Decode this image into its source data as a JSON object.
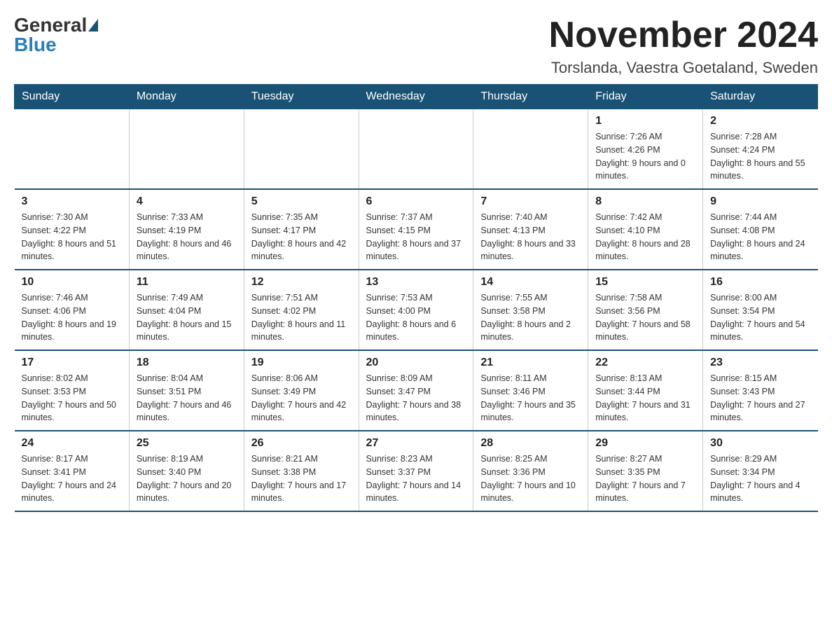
{
  "header": {
    "logo_general": "General",
    "logo_blue": "Blue",
    "month_title": "November 2024",
    "location": "Torslanda, Vaestra Goetaland, Sweden"
  },
  "weekdays": [
    "Sunday",
    "Monday",
    "Tuesday",
    "Wednesday",
    "Thursday",
    "Friday",
    "Saturday"
  ],
  "weeks": [
    [
      {
        "day": "",
        "info": ""
      },
      {
        "day": "",
        "info": ""
      },
      {
        "day": "",
        "info": ""
      },
      {
        "day": "",
        "info": ""
      },
      {
        "day": "",
        "info": ""
      },
      {
        "day": "1",
        "info": "Sunrise: 7:26 AM\nSunset: 4:26 PM\nDaylight: 9 hours and 0 minutes."
      },
      {
        "day": "2",
        "info": "Sunrise: 7:28 AM\nSunset: 4:24 PM\nDaylight: 8 hours and 55 minutes."
      }
    ],
    [
      {
        "day": "3",
        "info": "Sunrise: 7:30 AM\nSunset: 4:22 PM\nDaylight: 8 hours and 51 minutes."
      },
      {
        "day": "4",
        "info": "Sunrise: 7:33 AM\nSunset: 4:19 PM\nDaylight: 8 hours and 46 minutes."
      },
      {
        "day": "5",
        "info": "Sunrise: 7:35 AM\nSunset: 4:17 PM\nDaylight: 8 hours and 42 minutes."
      },
      {
        "day": "6",
        "info": "Sunrise: 7:37 AM\nSunset: 4:15 PM\nDaylight: 8 hours and 37 minutes."
      },
      {
        "day": "7",
        "info": "Sunrise: 7:40 AM\nSunset: 4:13 PM\nDaylight: 8 hours and 33 minutes."
      },
      {
        "day": "8",
        "info": "Sunrise: 7:42 AM\nSunset: 4:10 PM\nDaylight: 8 hours and 28 minutes."
      },
      {
        "day": "9",
        "info": "Sunrise: 7:44 AM\nSunset: 4:08 PM\nDaylight: 8 hours and 24 minutes."
      }
    ],
    [
      {
        "day": "10",
        "info": "Sunrise: 7:46 AM\nSunset: 4:06 PM\nDaylight: 8 hours and 19 minutes."
      },
      {
        "day": "11",
        "info": "Sunrise: 7:49 AM\nSunset: 4:04 PM\nDaylight: 8 hours and 15 minutes."
      },
      {
        "day": "12",
        "info": "Sunrise: 7:51 AM\nSunset: 4:02 PM\nDaylight: 8 hours and 11 minutes."
      },
      {
        "day": "13",
        "info": "Sunrise: 7:53 AM\nSunset: 4:00 PM\nDaylight: 8 hours and 6 minutes."
      },
      {
        "day": "14",
        "info": "Sunrise: 7:55 AM\nSunset: 3:58 PM\nDaylight: 8 hours and 2 minutes."
      },
      {
        "day": "15",
        "info": "Sunrise: 7:58 AM\nSunset: 3:56 PM\nDaylight: 7 hours and 58 minutes."
      },
      {
        "day": "16",
        "info": "Sunrise: 8:00 AM\nSunset: 3:54 PM\nDaylight: 7 hours and 54 minutes."
      }
    ],
    [
      {
        "day": "17",
        "info": "Sunrise: 8:02 AM\nSunset: 3:53 PM\nDaylight: 7 hours and 50 minutes."
      },
      {
        "day": "18",
        "info": "Sunrise: 8:04 AM\nSunset: 3:51 PM\nDaylight: 7 hours and 46 minutes."
      },
      {
        "day": "19",
        "info": "Sunrise: 8:06 AM\nSunset: 3:49 PM\nDaylight: 7 hours and 42 minutes."
      },
      {
        "day": "20",
        "info": "Sunrise: 8:09 AM\nSunset: 3:47 PM\nDaylight: 7 hours and 38 minutes."
      },
      {
        "day": "21",
        "info": "Sunrise: 8:11 AM\nSunset: 3:46 PM\nDaylight: 7 hours and 35 minutes."
      },
      {
        "day": "22",
        "info": "Sunrise: 8:13 AM\nSunset: 3:44 PM\nDaylight: 7 hours and 31 minutes."
      },
      {
        "day": "23",
        "info": "Sunrise: 8:15 AM\nSunset: 3:43 PM\nDaylight: 7 hours and 27 minutes."
      }
    ],
    [
      {
        "day": "24",
        "info": "Sunrise: 8:17 AM\nSunset: 3:41 PM\nDaylight: 7 hours and 24 minutes."
      },
      {
        "day": "25",
        "info": "Sunrise: 8:19 AM\nSunset: 3:40 PM\nDaylight: 7 hours and 20 minutes."
      },
      {
        "day": "26",
        "info": "Sunrise: 8:21 AM\nSunset: 3:38 PM\nDaylight: 7 hours and 17 minutes."
      },
      {
        "day": "27",
        "info": "Sunrise: 8:23 AM\nSunset: 3:37 PM\nDaylight: 7 hours and 14 minutes."
      },
      {
        "day": "28",
        "info": "Sunrise: 8:25 AM\nSunset: 3:36 PM\nDaylight: 7 hours and 10 minutes."
      },
      {
        "day": "29",
        "info": "Sunrise: 8:27 AM\nSunset: 3:35 PM\nDaylight: 7 hours and 7 minutes."
      },
      {
        "day": "30",
        "info": "Sunrise: 8:29 AM\nSunset: 3:34 PM\nDaylight: 7 hours and 4 minutes."
      }
    ]
  ]
}
